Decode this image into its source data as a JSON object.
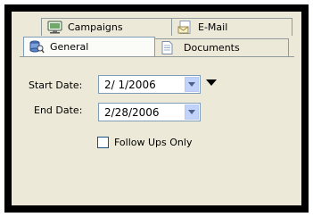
{
  "tabs": {
    "campaigns": "Campaigns",
    "email": "E-Mail",
    "general": "General",
    "documents": "Documents"
  },
  "form": {
    "start_date_label": "Start Date:",
    "start_date_value": "2/ 1/2006",
    "end_date_label": "End Date:",
    "end_date_value": "2/28/2006",
    "follow_ups_label": "Follow Ups Only",
    "follow_ups_checked": false
  },
  "icons": {
    "campaigns": "monitor-icon",
    "email": "email-document-icon",
    "general": "search-database-icon",
    "documents": "document-icon"
  }
}
